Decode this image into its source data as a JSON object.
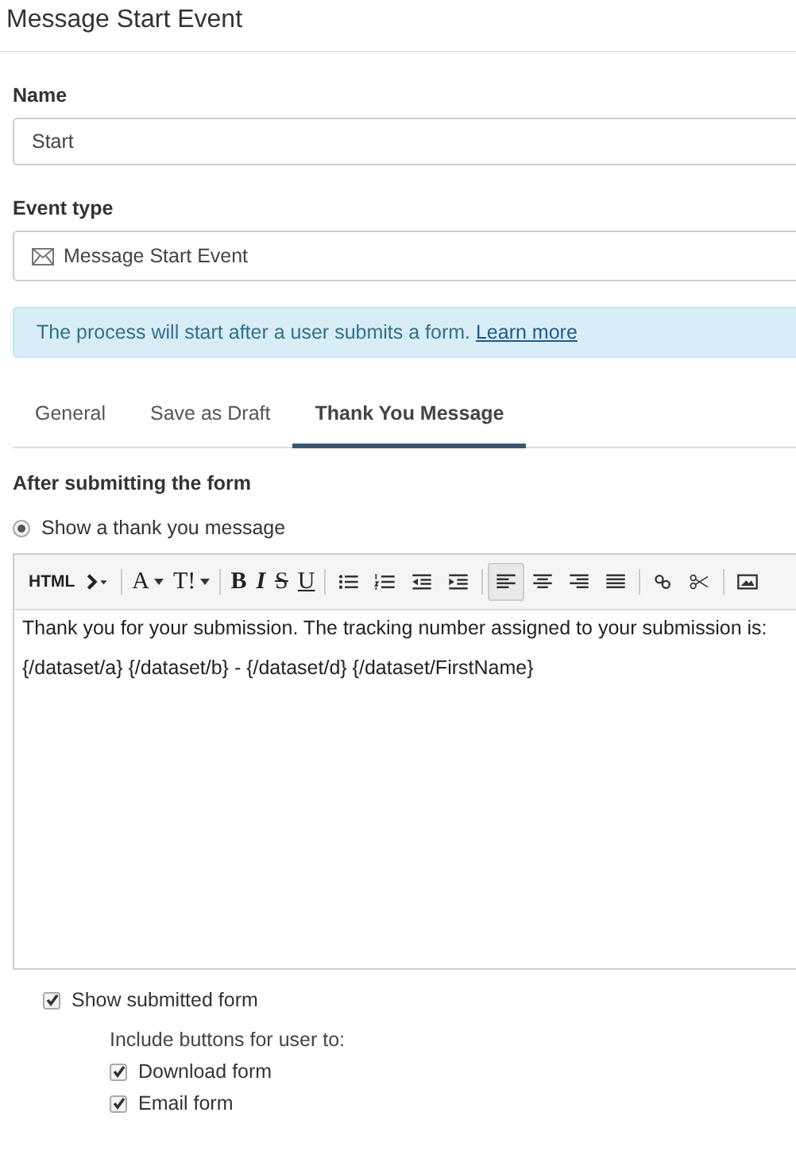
{
  "panel": {
    "title": "Message Start Event"
  },
  "name_field": {
    "label": "Name",
    "value": "Start"
  },
  "event_type": {
    "label": "Event type",
    "value": "Message Start Event"
  },
  "info": {
    "text": "The process will start after a user submits a form.",
    "link": "Learn more"
  },
  "tabs": [
    {
      "label": "General",
      "selected": false
    },
    {
      "label": "Save as Draft",
      "selected": false
    },
    {
      "label": "Thank You Message",
      "selected": true
    }
  ],
  "section_title": "After submitting the form",
  "radio": {
    "label": "Show a thank you message",
    "selected": true
  },
  "toolbar": {
    "groups": [
      [
        {
          "kind": "text",
          "label": "HTML",
          "selected": false
        },
        {
          "kind": "icon",
          "selected": false
        }
      ],
      [
        {
          "kind": "serif-caret",
          "label": "A",
          "selected": false
        },
        {
          "kind": "serif-caret",
          "label": "T!",
          "selected": false
        }
      ],
      [
        {
          "kind": "bold",
          "label": "B",
          "selected": false
        },
        {
          "kind": "italic",
          "label": "I",
          "selected": false
        },
        {
          "kind": "strike",
          "label": "S",
          "selected": false
        },
        {
          "kind": "underline",
          "label": "U",
          "selected": false
        }
      ],
      [
        {
          "kind": "icon",
          "selected": false
        },
        {
          "kind": "icon",
          "selected": false
        },
        {
          "kind": "icon",
          "selected": false
        },
        {
          "kind": "icon",
          "selected": false
        }
      ],
      [
        {
          "kind": "icon",
          "selected": true
        },
        {
          "kind": "icon",
          "selected": false
        },
        {
          "kind": "icon",
          "selected": false
        },
        {
          "kind": "icon",
          "selected": false
        }
      ],
      [
        {
          "kind": "icon",
          "selected": false
        },
        {
          "kind": "icon",
          "selected": false
        }
      ],
      [
        {
          "kind": "icon",
          "selected": false
        }
      ]
    ]
  },
  "editor": {
    "lines": [
      "Thank you for your submission. The tracking number assigned to your submission is:",
      "{/dataset/a} {/dataset/b} - {/dataset/d} {/dataset/FirstName}"
    ]
  },
  "show_submitted": {
    "label": "Show submitted form",
    "checked": true
  },
  "include_label": "Include buttons for user to:",
  "options": [
    {
      "label": "Download form",
      "checked": true
    },
    {
      "label": "Email form",
      "checked": true
    }
  ]
}
